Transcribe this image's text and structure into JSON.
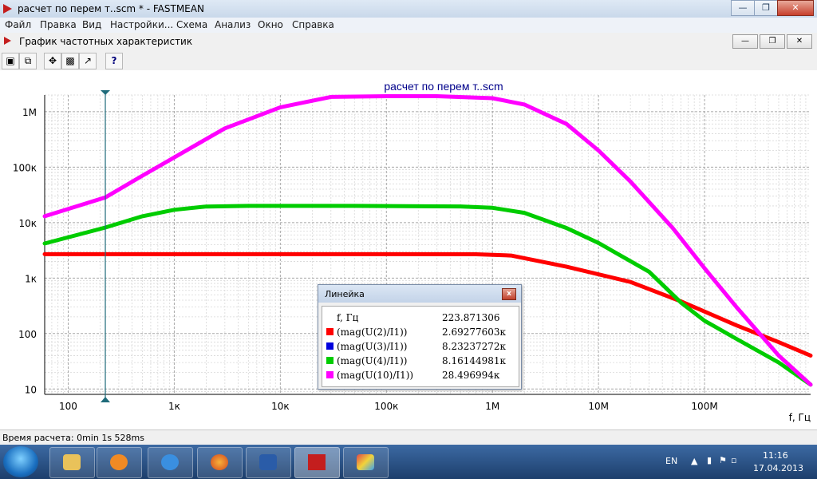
{
  "window": {
    "title": "расчет по перем т..scm * - FASTMEAN"
  },
  "menu": [
    "Файл",
    "Правка",
    "Вид",
    "Настройки...",
    "Схема",
    "Анализ",
    "Окно",
    "Справка"
  ],
  "subwindow": {
    "title": "График частотных характеристик"
  },
  "toolbar": {
    "help_label": "?"
  },
  "chart_data": {
    "type": "line",
    "title": "расчет по перем т..scm",
    "xlabel": "f, Гц",
    "ylabel": "",
    "xscale": "log",
    "yscale": "log",
    "xlim": [
      60,
      1000000000
    ],
    "ylim": [
      8,
      2000000
    ],
    "grid": true,
    "legend": "none",
    "x_tick_labels": [
      "100",
      "1к",
      "10к",
      "100к",
      "1M",
      "10M",
      "100M"
    ],
    "x_ticks": [
      100,
      1000,
      10000,
      100000,
      1000000,
      10000000,
      100000000
    ],
    "y_tick_labels": [
      "10",
      "100",
      "1к",
      "10к",
      "100к",
      "1M"
    ],
    "y_ticks": [
      10,
      100,
      1000,
      10000,
      100000,
      1000000
    ],
    "cursor_x": 223.871306,
    "series": [
      {
        "name": "mag(U(2)/I1)",
        "color": "#ff0000",
        "x": [
          60,
          1000,
          10000,
          100000,
          700000,
          1500000,
          5000000,
          20000000,
          60000000,
          200000000,
          500000000,
          1000000000
        ],
        "y": [
          2700,
          2700,
          2700,
          2700,
          2690,
          2550,
          1600,
          850,
          380,
          140,
          70,
          40
        ]
      },
      {
        "name": "mag(U(4)/I1)",
        "color": "#00cc00",
        "x": [
          60,
          223.87,
          500,
          1000,
          2000,
          5000,
          50000,
          500000,
          1000000,
          2000000,
          5000000,
          10000000,
          30000000,
          60000000,
          100000000,
          200000000,
          500000000,
          1000000000
        ],
        "y": [
          4200,
          8161,
          13000,
          17000,
          19500,
          20000,
          20000,
          19600,
          18500,
          15000,
          8000,
          4300,
          1300,
          360,
          170,
          80,
          30,
          12
        ]
      },
      {
        "name": "mag(U(10)/I1)",
        "color": "#ff00ff",
        "x": [
          60,
          223.87,
          500,
          1000,
          3000,
          10000,
          30000,
          100000,
          300000,
          1000000,
          2000000,
          5000000,
          10000000,
          20000000,
          50000000,
          100000000,
          200000000,
          500000000,
          1000000000
        ],
        "y": [
          13000,
          28497,
          70000,
          150000,
          500000,
          1200000,
          1850000,
          1900000,
          1900000,
          1750000,
          1350000,
          600000,
          200000,
          55000,
          8000,
          1500,
          300,
          40,
          12
        ]
      }
    ]
  },
  "ruler": {
    "title": "Линейка",
    "close_label": "x",
    "freq_label": "f, Гц",
    "freq_value": "223.871306",
    "rows": [
      {
        "label": "(mag(U(2)/I1))",
        "value": "2.69277603к",
        "color": "#ff0000"
      },
      {
        "label": "(mag(U(3)/I1))",
        "value": "8.23237272к",
        "color": "#0000dd"
      },
      {
        "label": "(mag(U(4)/I1))",
        "value": "8.16144981к",
        "color": "#00cc00"
      },
      {
        "label": "(mag(U(10)/I1))",
        "value": "28.496994к",
        "color": "#ff00ff"
      }
    ]
  },
  "status": {
    "text": "Время расчета: 0min 1s 528ms"
  },
  "taskbar": {
    "lang": "EN",
    "time": "11:16",
    "date": "17.04.2013"
  }
}
